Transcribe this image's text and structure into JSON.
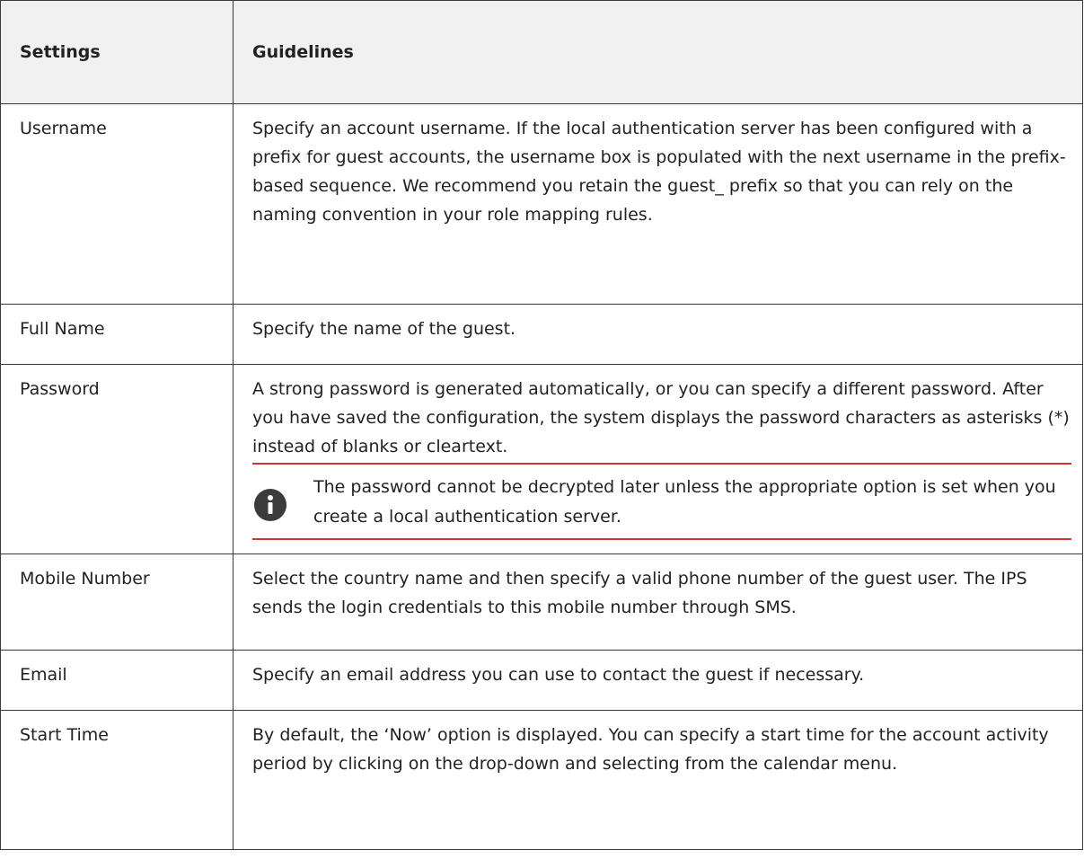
{
  "table": {
    "headers": [
      "Settings",
      "Guidelines"
    ],
    "rows": [
      {
        "setting": "Username",
        "guideline": "Specify an account username. If the local authentication server has been configured with a prefix for guest accounts, the username box is populated with the next username in the prefix-based sequence. We recommend you retain the guest_ prefix so that you can rely on the naming convention in your role mapping rules."
      },
      {
        "setting": "Full Name",
        "guideline": "Specify the name of the guest."
      },
      {
        "setting": "Password",
        "guideline": "A strong password is generated automatically, or you can specify a different password. After you have saved the configuration, the system displays the password characters as asterisks (*) instead of blanks or cleartext.",
        "note": {
          "icon": "info-icon",
          "text": "The password cannot be decrypted later unless the appropriate option is set when you create a local authentication server."
        }
      },
      {
        "setting": "Mobile Number",
        "guideline": "Select the country name and then specify a valid phone number of the guest user. The IPS sends the login credentials to this mobile number through SMS."
      },
      {
        "setting": "Email",
        "guideline": "Specify an email address you can use to contact the guest if necessary."
      },
      {
        "setting": "Start Time",
        "guideline": "By default, the ‘Now’ option is displayed. You can specify a start time for the account activity period by clicking on the drop-down and selecting from the calendar menu."
      }
    ]
  },
  "colors": {
    "header_background": "#f1f1f1",
    "border": "#3a3a3a",
    "note_rule": "#cc3333",
    "icon": "#3b3b3b"
  }
}
